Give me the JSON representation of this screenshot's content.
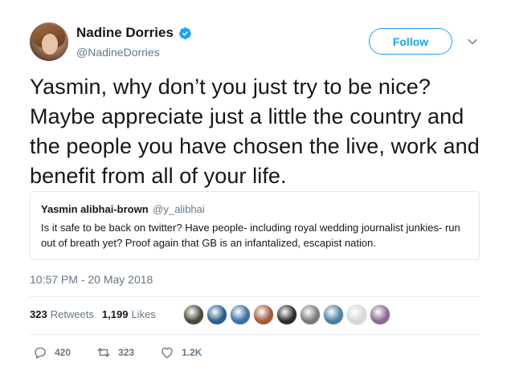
{
  "author": {
    "display_name": "Nadine Dorries",
    "handle": "@NadineDorries",
    "verified": true
  },
  "follow_button_label": "Follow",
  "tweet_text": "Yasmin, why don’t you just try to be nice? Maybe appreciate just a little the country and the people you have chosen the live, work and benefit from all of your life.",
  "quoted_tweet": {
    "display_name": "Yasmin alibhai-brown",
    "handle": "@y_alibhai",
    "text": "Is it safe to be back on twitter? Have people- including royal wedding journalist junkies- run out of breath yet? Proof again that GB is an infantalized, escapist nation."
  },
  "timestamp": "10:57 PM - 20 May 2018",
  "stats": {
    "retweets_count": "323",
    "retweets_label": "Retweets",
    "likes_count": "1,199",
    "likes_label": "Likes"
  },
  "liker_avatars": [
    {
      "icon": "liker-avatar-1",
      "color": "#4a4a3a"
    },
    {
      "icon": "liker-avatar-2",
      "color": "#2b5f8a"
    },
    {
      "icon": "liker-avatar-3",
      "color": "#3d6fa8"
    },
    {
      "icon": "liker-avatar-4",
      "color": "#a55a3c"
    },
    {
      "icon": "liker-avatar-5",
      "color": "#2b2b2b"
    },
    {
      "icon": "liker-avatar-6",
      "color": "#7a7a7a"
    },
    {
      "icon": "liker-avatar-7",
      "color": "#4e7fa3"
    },
    {
      "icon": "liker-avatar-8",
      "color": "#d8d8d8"
    },
    {
      "icon": "liker-avatar-9",
      "color": "#8a6a8f"
    }
  ],
  "actions": {
    "reply_count": "420",
    "retweet_count": "323",
    "like_count": "1.2K"
  },
  "colors": {
    "accent": "#1da1f2",
    "secondary_text": "#657786"
  }
}
